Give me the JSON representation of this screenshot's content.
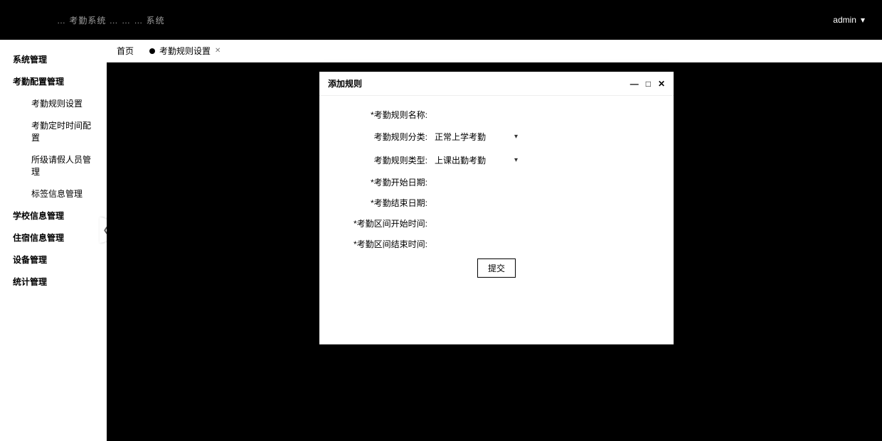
{
  "topbar": {
    "left_text": "… 考勤系统 … … … 系统",
    "user_label": "admin"
  },
  "sidebar": {
    "items": [
      {
        "label": "系统管理",
        "bold": true
      },
      {
        "label": "考勤配置管理",
        "bold": true
      },
      {
        "label": "考勤规则设置",
        "sub": true
      },
      {
        "label": "考勤定时时间配置",
        "sub": true
      },
      {
        "label": "所级请假人员管理",
        "sub": true
      },
      {
        "label": "标签信息管理",
        "sub": true
      },
      {
        "label": "学校信息管理",
        "bold": true
      },
      {
        "label": "住宿信息管理",
        "bold": true
      },
      {
        "label": "设备管理",
        "bold": true
      },
      {
        "label": "统计管理",
        "bold": true
      }
    ]
  },
  "tabs": {
    "home": "首页",
    "active": "考勤规则设置"
  },
  "modal": {
    "title": "添加规则",
    "fields": {
      "rule_name_label": "考勤规则名称:",
      "rule_name_value": "",
      "rule_category_label": "考勤规则分类:",
      "rule_category_value": "正常上学考勤",
      "rule_type_label": "考勤规则类型:",
      "rule_type_value": "上课出勤考勤",
      "start_date_label": "考勤开始日期:",
      "start_date_value": "",
      "end_date_label": "考勤结束日期:",
      "end_date_value": "",
      "interval_start_label": "考勤区间开始时间:",
      "interval_start_value": "",
      "interval_end_label": "考勤区间结束时间:",
      "interval_end_value": ""
    },
    "submit_label": "提交"
  }
}
